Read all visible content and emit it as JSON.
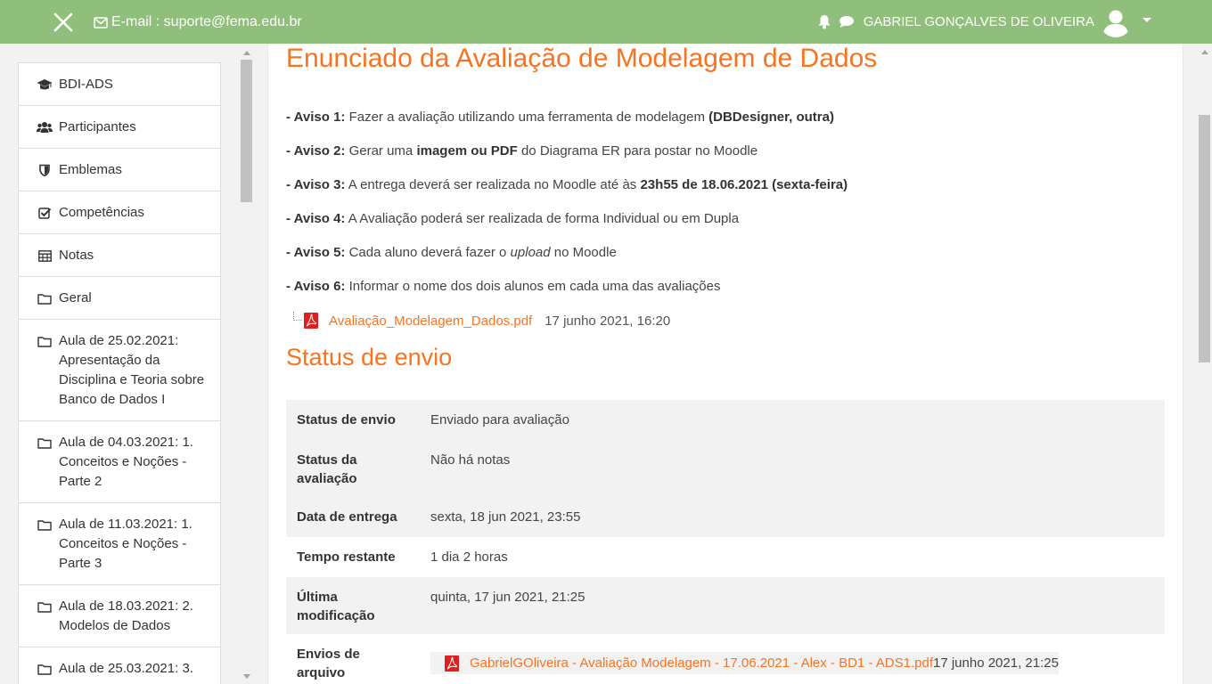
{
  "navbar": {
    "email_label": "E-mail : suporte@fema.edu.br",
    "user_name": "GABRIEL GONÇALVES DE OLIVEIRA",
    "bg_color": "#8fbf7a"
  },
  "sidebar": {
    "items": [
      {
        "label": "BDI-ADS",
        "icon": "graduation-cap-icon"
      },
      {
        "label": "Participantes",
        "icon": "users-icon"
      },
      {
        "label": "Emblemas",
        "icon": "shield-icon"
      },
      {
        "label": "Competências",
        "icon": "check-square-icon"
      },
      {
        "label": "Notas",
        "icon": "table-icon"
      },
      {
        "label": "Geral",
        "icon": "folder-icon"
      },
      {
        "label": "Aula de 25.02.2021: Apresentação da Disciplina e Teoria sobre Banco de Dados I",
        "icon": "folder-icon"
      },
      {
        "label": "Aula de 04.03.2021: 1. Conceitos e Noções - Parte 2",
        "icon": "folder-icon"
      },
      {
        "label": "Aula de 11.03.2021: 1. Conceitos e Noções - Parte 3",
        "icon": "folder-icon"
      },
      {
        "label": "Aula de 18.03.2021: 2. Modelos de Dados",
        "icon": "folder-icon"
      },
      {
        "label": "Aula de 25.03.2021: 3.",
        "icon": "folder-icon"
      }
    ]
  },
  "main": {
    "title": "Enunciado da Avaliação de Modelagem de Dados",
    "notices": [
      {
        "prefix": "- Aviso 1:",
        "parts": [
          {
            "t": "  Fazer a avaliação utilizando uma ferramenta de modelagem ",
            "s": ""
          },
          {
            "t": "(DBDesigner, outra)",
            "s": "b"
          }
        ]
      },
      {
        "prefix": "- Aviso 2:",
        "parts": [
          {
            "t": " Gerar uma ",
            "s": ""
          },
          {
            "t": "imagem ou PDF",
            "s": "b"
          },
          {
            "t": " do Diagrama ER para postar no Moodle",
            "s": ""
          }
        ]
      },
      {
        "prefix": "- Aviso 3:",
        "parts": [
          {
            "t": " A entrega deverá ser realizada no Moodle até às ",
            "s": ""
          },
          {
            "t": "23h55 de 18.06.2021 (sexta-feira)",
            "s": "b"
          }
        ]
      },
      {
        "prefix": "- Aviso 4:",
        "parts": [
          {
            "t": " A Avaliação poderá ser realizada de forma Individual ou em Dupla",
            "s": ""
          }
        ]
      },
      {
        "prefix": "- Aviso 5:",
        "parts": [
          {
            "t": " Cada aluno deverá fazer o ",
            "s": ""
          },
          {
            "t": "upload",
            "s": "i"
          },
          {
            "t": " no Moodle",
            "s": ""
          }
        ]
      },
      {
        "prefix": "- Aviso 6:",
        "parts": [
          {
            "t": " Informar o nome dos dois alunos em cada uma das avaliações",
            "s": ""
          }
        ]
      }
    ],
    "attachment": {
      "name": "Avaliação_Modelagem_Dados.pdf",
      "date": "17 junho 2021, 16:20"
    },
    "status_title": "Status de envio",
    "status_rows": [
      {
        "label": "Status de envio",
        "value": "Enviado para avaliação"
      },
      {
        "label": "Status da avaliação",
        "value": "Não há notas"
      },
      {
        "label": "Data de entrega",
        "value": "sexta, 18 jun 2021, 23:55"
      },
      {
        "label": "Tempo restante",
        "value": "1 dia 2 horas"
      },
      {
        "label": "Última modificação",
        "value": "quinta, 17 jun 2021, 21:25"
      },
      {
        "label": "Envios de arquivo",
        "value": ""
      }
    ],
    "submission_file": {
      "name": "GabrielGOliveira - Avaliação Modelagem - 17.06.2021 - Alex - BD1 - ADS1.pdf",
      "date": "17 junho 2021, 21:25"
    },
    "accent_color": "#f7731f"
  }
}
